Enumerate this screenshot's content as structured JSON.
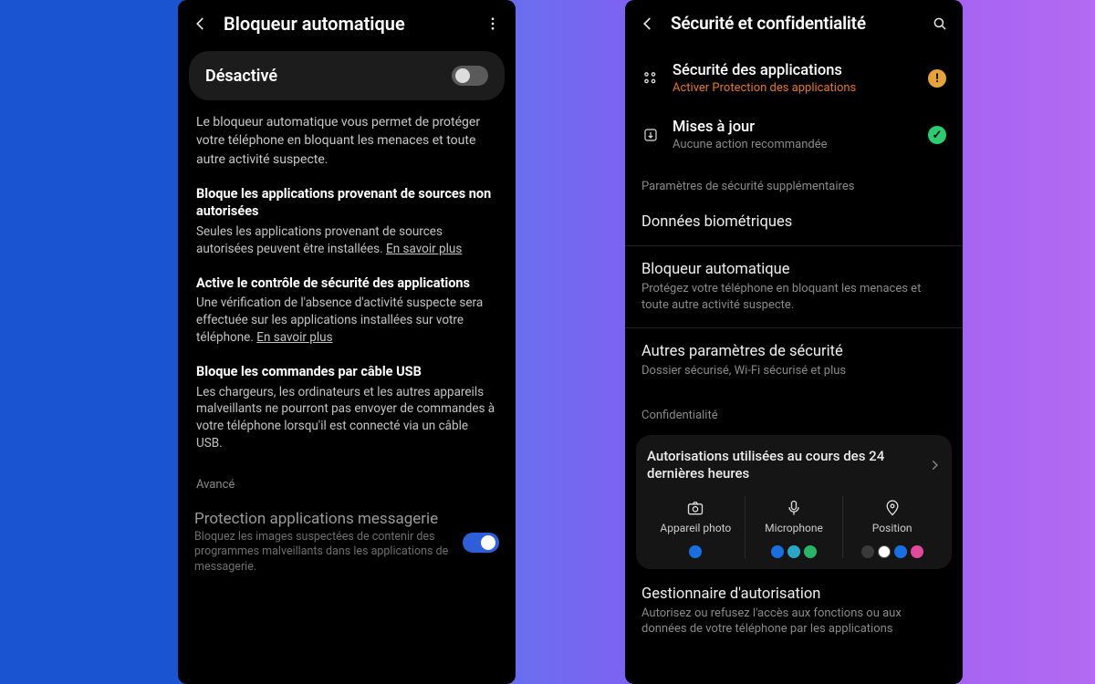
{
  "left": {
    "title": "Bloqueur automatique",
    "toggle": {
      "label": "Désactivé",
      "on": false
    },
    "intro": "Le bloqueur automatique vous permet de protéger votre téléphone en bloquant les menaces et toute autre activité suspecte.",
    "features": [
      {
        "title": "Bloque les applications provenant de sources non autorisées",
        "desc": "Seules les applications provenant de sources autorisées peuvent être installées.",
        "link": "En savoir plus"
      },
      {
        "title": "Active le contrôle de sécurité des applications",
        "desc": "Une vérification de l'absence d'activité suspecte sera effectuée sur les applications installées sur votre téléphone.",
        "link": "En savoir plus"
      },
      {
        "title": "Bloque les commandes par câble USB",
        "desc": "Les chargeurs, les ordinateurs et les autres appareils malveillants ne pourront pas envoyer de commandes à votre téléphone lorsqu'il est connecté via un câble USB.",
        "link": ""
      }
    ],
    "advanced_header": "Avancé",
    "advanced_row": {
      "title": "Protection applications messagerie",
      "sub": "Bloquez les images suspectées de contenir des programmes malveillants dans les applications de messagerie.",
      "on": true
    }
  },
  "right": {
    "title": "Sécurité et confidentialité",
    "status": [
      {
        "icon": "apps",
        "title": "Sécurité des applications",
        "sub": "Activer Protection des applications",
        "sub_style": "orange",
        "badge": "warn",
        "badge_glyph": "!"
      },
      {
        "icon": "shield-update",
        "title": "Mises à jour",
        "sub": "Aucune action recommandée",
        "sub_style": "",
        "badge": "ok",
        "badge_glyph": "✓"
      }
    ],
    "section1": "Paramètres de sécurité supplémentaires",
    "items1": [
      {
        "title": "Données biométriques",
        "sub": ""
      },
      {
        "title": "Bloqueur automatique",
        "sub": "Protégez votre téléphone en bloquant les menaces et toute autre activité suspecte."
      },
      {
        "title": "Autres paramètres de sécurité",
        "sub": "Dossier sécurisé, Wi-Fi sécurisé et plus"
      }
    ],
    "section2": "Confidentialité",
    "permissions": {
      "title": "Autorisations utilisées au cours des 24 dernières heures",
      "cols": [
        {
          "icon": "camera",
          "label": "Appareil photo",
          "dots": [
            "#1a6fe0"
          ]
        },
        {
          "icon": "mic",
          "label": "Microphone",
          "dots": [
            "#1a6fe0",
            "#2aa6c9",
            "#29b567"
          ]
        },
        {
          "icon": "location",
          "label": "Position",
          "dots": [
            "#3a3a3a",
            "#ffffff",
            "#1a6fe0",
            "#e04a9a"
          ]
        }
      ]
    },
    "manager": {
      "title": "Gestionnaire d'autorisation",
      "sub": "Autorisez ou refusez l'accès aux fonctions ou aux données de votre téléphone par les applications"
    }
  }
}
